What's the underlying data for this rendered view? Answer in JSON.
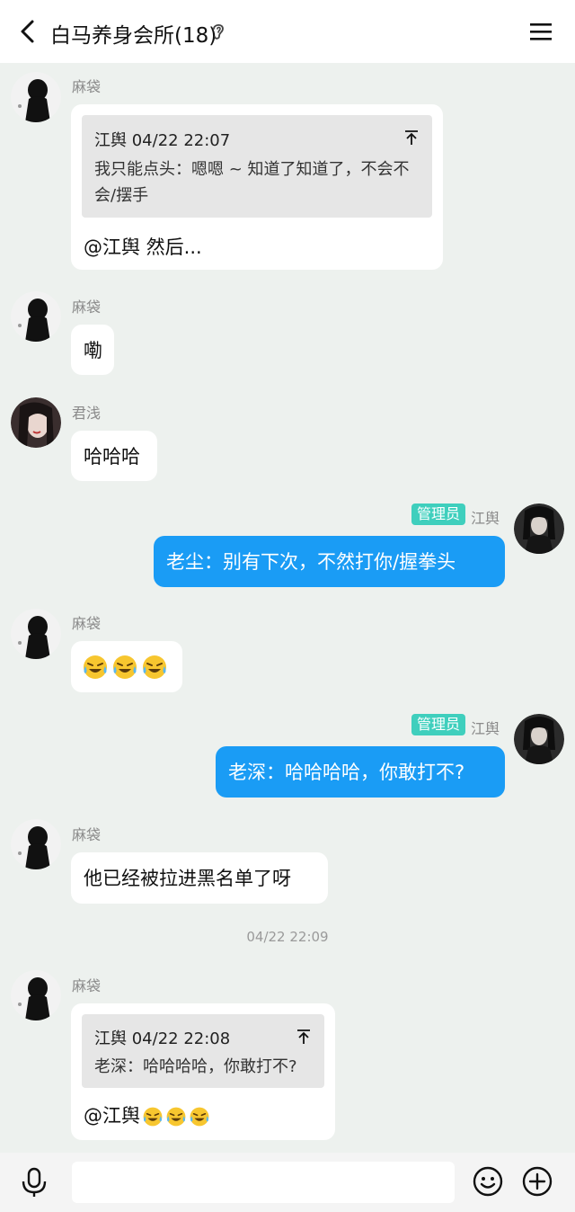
{
  "header": {
    "title": "白马养身会所(18)",
    "back_icon": "chevron-left-icon",
    "ear_icon": "ear-icon",
    "menu_icon": "hamburger-menu-icon"
  },
  "messages": {
    "m1": {
      "sender": "麻袋",
      "quote_author_time": "江舆 04/22 22:07",
      "quote_text": "我只能点头：嗯嗯 ~ 知道了知道了，不会不会/摆手",
      "reply": "@江舆 然后..."
    },
    "m2": {
      "sender": "麻袋",
      "text": "嘞"
    },
    "m3": {
      "sender": "君浅",
      "text": "哈哈哈"
    },
    "m4": {
      "badge": "管理员",
      "sender": "江舆",
      "text": "老尘：别有下次，不然打你/握拳头"
    },
    "m5": {
      "sender": "麻袋",
      "emoji": "laughing-tears-emoji x3"
    },
    "m6": {
      "badge": "管理员",
      "sender": "江舆",
      "text": "老深：哈哈哈哈，你敢打不?"
    },
    "m7": {
      "sender": "麻袋",
      "text": "他已经被拉进黑名单了呀"
    },
    "timestamp": "04/22 22:09",
    "m8": {
      "sender": "麻袋",
      "quote_author_time": "江舆 04/22 22:08",
      "quote_text": "老深：哈哈哈哈，你敢打不?",
      "reply": "@江舆"
    }
  },
  "input_bar": {
    "mic_icon": "microphone-icon",
    "input_value": "",
    "emoji_icon": "smiley-icon",
    "plus_icon": "plus-circle-icon"
  },
  "colors": {
    "background": "#edf1ee",
    "blue_bubble": "#1a9cf5",
    "admin_badge": "#3fcfbd"
  }
}
